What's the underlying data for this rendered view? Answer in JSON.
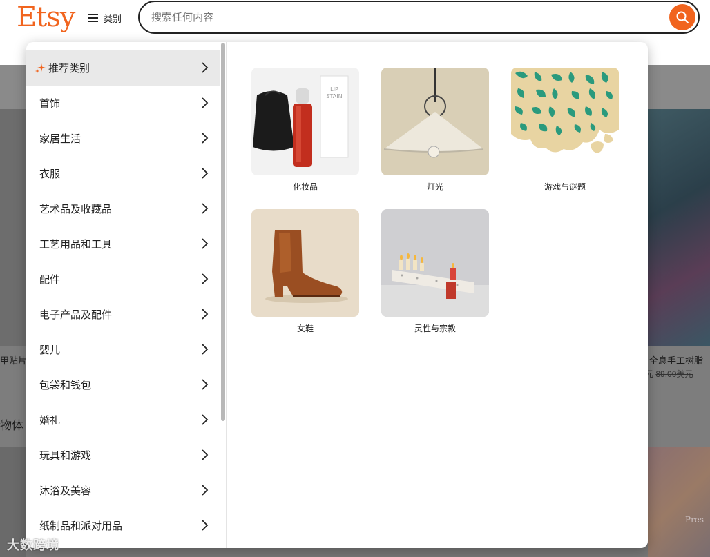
{
  "header": {
    "logo": "Etsy",
    "categories_label": "类别",
    "search_placeholder": "搜索任何内容"
  },
  "categories": [
    {
      "label": "推荐类别",
      "active": true
    },
    {
      "label": "首饰"
    },
    {
      "label": "家居生活"
    },
    {
      "label": "衣服"
    },
    {
      "label": "艺术品及收藏品"
    },
    {
      "label": "工艺用品和工具"
    },
    {
      "label": "配件"
    },
    {
      "label": "电子产品及配件"
    },
    {
      "label": "婴儿"
    },
    {
      "label": "包袋和钱包"
    },
    {
      "label": "婚礼"
    },
    {
      "label": "玩具和游戏"
    },
    {
      "label": "沐浴及美容"
    },
    {
      "label": "纸制品和派对用品"
    }
  ],
  "featured": [
    {
      "label": "化妆品"
    },
    {
      "label": "灯光"
    },
    {
      "label": "游戏与谜题"
    },
    {
      "label": "女鞋"
    },
    {
      "label": "灵性与宗教"
    }
  ],
  "tile_image_text": {
    "stain_box_line1": "LIP",
    "stain_box_line2": "STAIN"
  },
  "background": {
    "left_text": "甲贴片",
    "left_heading": "物体",
    "right_text": "全息手工树脂",
    "right_price_prefix": "元 ",
    "right_price_old": "89.00美元",
    "right_corner_text": "Pres"
  },
  "watermark": "大数跨境",
  "colors": {
    "brand": "#f1641e",
    "active_bg": "#e9e9e9"
  }
}
